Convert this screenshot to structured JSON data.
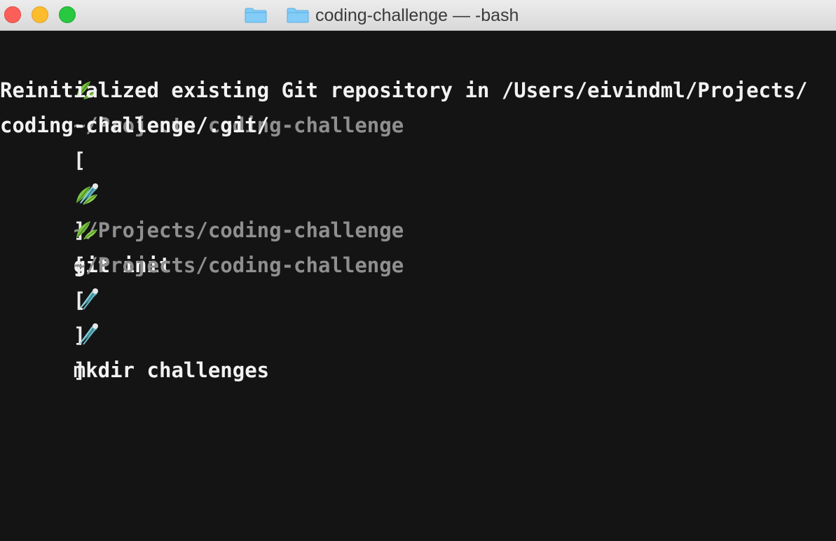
{
  "window": {
    "title": "coding-challenge — -bash",
    "proxy_icon": "folder-icon",
    "title_icon": "folder-icon"
  },
  "colors": {
    "background": "#141414",
    "path": "#8f8f8f",
    "text": "#f2f2f2",
    "close": "#fc5f57",
    "minimize": "#fdbc2e",
    "zoom": "#28c840",
    "folder": "#6ec3f5"
  },
  "prompt": {
    "leaf_icon": "leaf-icon",
    "path": "~/Projects/coding-challenge",
    "open_bracket": "[",
    "comet_icon": "comet-icon",
    "close_bracket": "]"
  },
  "lines": [
    {
      "type": "prompt",
      "command": "git init"
    },
    {
      "type": "output",
      "text": "Reinitialized existing Git repository in /Users/eivindml/Projects/"
    },
    {
      "type": "output",
      "text": "coding-challenge/.git/"
    },
    {
      "type": "prompt",
      "command": "mkdir challenges"
    },
    {
      "type": "prompt",
      "command": ""
    }
  ]
}
